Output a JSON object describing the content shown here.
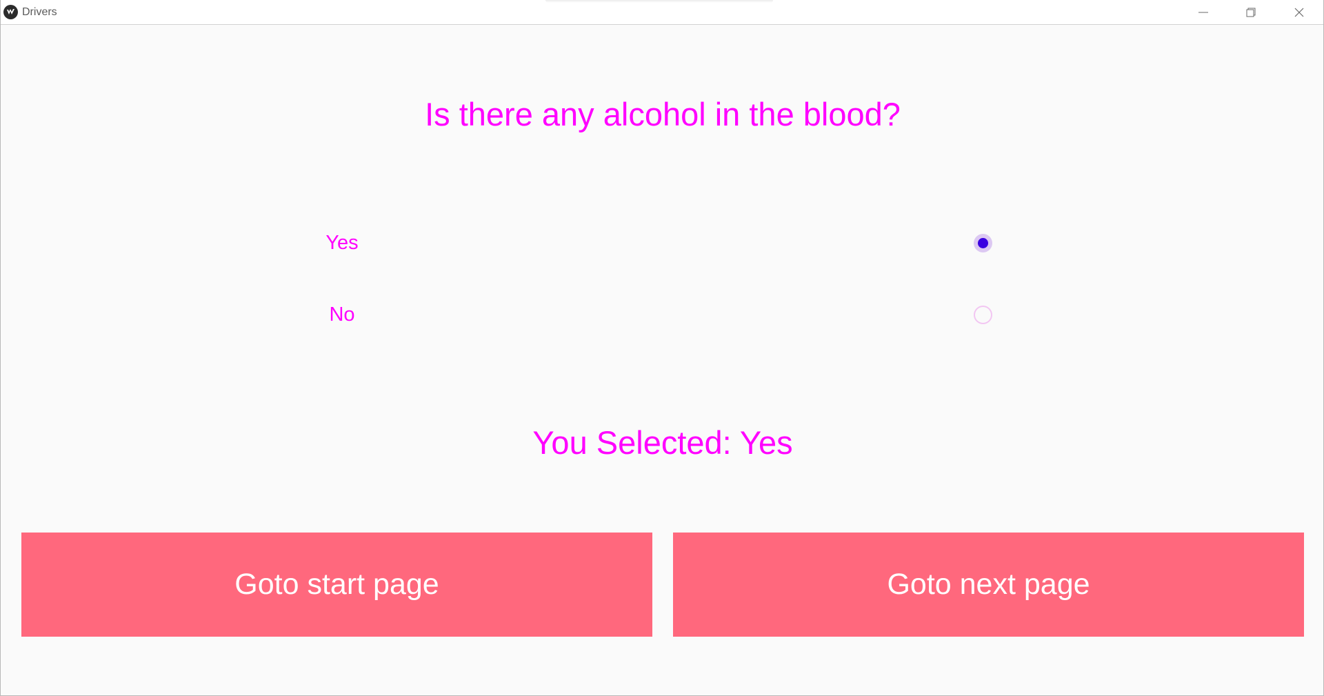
{
  "window": {
    "title": "Drivers",
    "app_icon": "kivy-logo-icon",
    "controls": [
      "minimize-icon",
      "restore-icon",
      "close-icon"
    ]
  },
  "question": {
    "text": "Is there any alcohol in the blood?"
  },
  "options": [
    {
      "label": "Yes",
      "selected": true
    },
    {
      "label": "No",
      "selected": false
    }
  ],
  "selection_display": {
    "text": "You Selected: Yes"
  },
  "buttons": {
    "start_label": "Goto start page",
    "next_label": "Goto next page"
  },
  "colors": {
    "text_accent": "#ff00ff",
    "button_bg": "#ff687d",
    "button_text": "#ffffff",
    "radio_selected": "#3a00e0",
    "background": "#fafafa"
  }
}
